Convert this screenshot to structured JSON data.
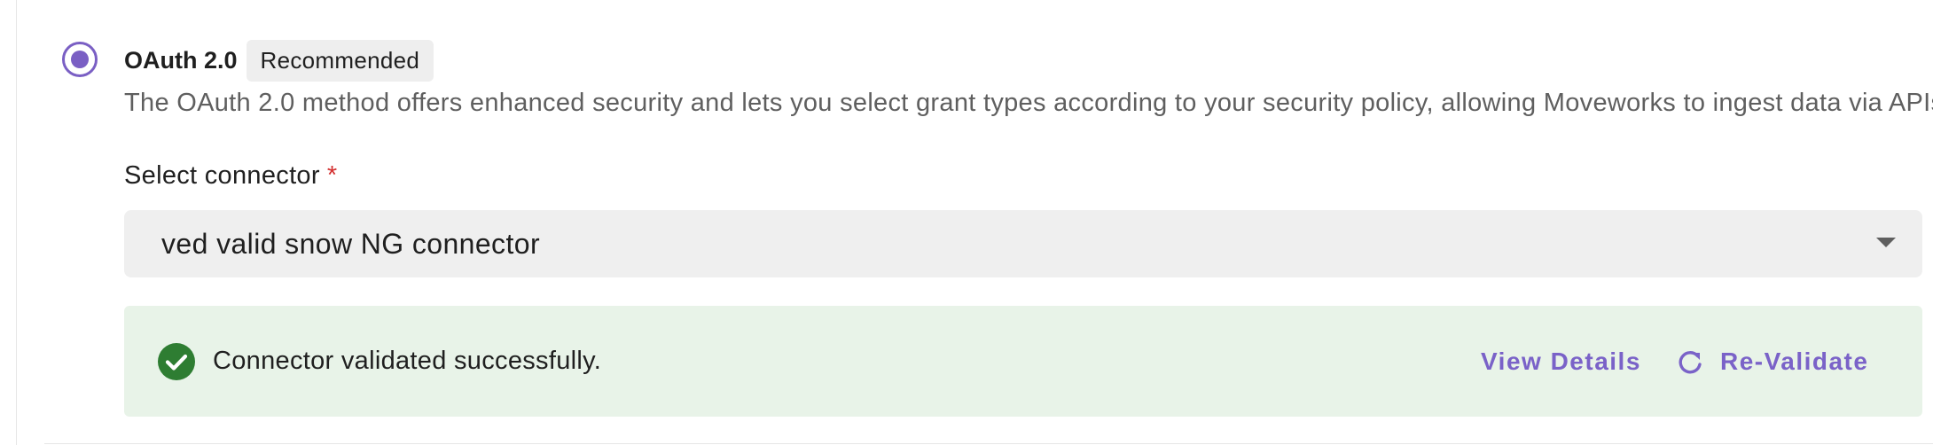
{
  "option": {
    "name": "OAuth 2.0",
    "badge": "Recommended",
    "selected": true,
    "description": "The OAuth 2.0 method offers enhanced security and lets you select grant types according to your security policy, allowing Moveworks to ingest data via APIs"
  },
  "connector_field": {
    "label": "Select connector",
    "required_mark": "*",
    "value": "ved valid snow NG connector",
    "arrow_icon": "dropdown-arrow-icon"
  },
  "validation": {
    "icon": "check-circle-icon",
    "message": "Connector validated successfully.",
    "view_details_label": "View Details",
    "revalidate_label": "Re-Validate",
    "revalidate_icon": "refresh-icon"
  },
  "colors": {
    "accent": "#7a5fc4",
    "success_bg": "#e8f3e8",
    "success_icon": "#2e7d32",
    "required": "#d32f2f",
    "select_bg": "#efefef"
  }
}
